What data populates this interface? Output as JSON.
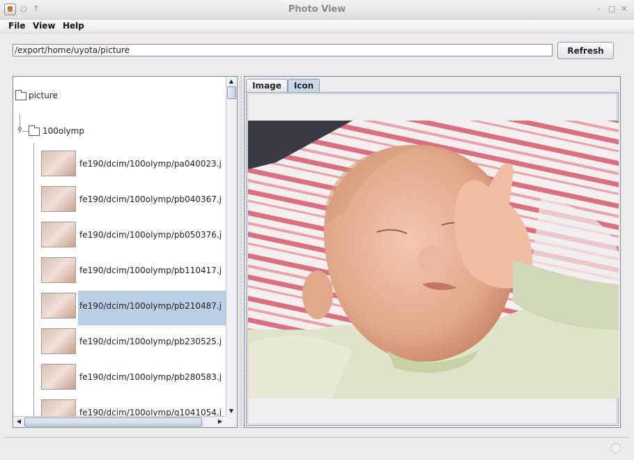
{
  "window": {
    "title": "Photo View",
    "icons": [
      "app-icon",
      "circle-icon",
      "up-arrow-icon",
      "minimize-icon",
      "maximize-icon",
      "close-icon"
    ]
  },
  "menubar": {
    "items": [
      "File",
      "View",
      "Help"
    ]
  },
  "toolbar": {
    "path_value": "/export/home/uyota/picture",
    "refresh_label": "Refresh"
  },
  "tree": {
    "root_label": "picture",
    "folder_label": "100olymp",
    "items": [
      {
        "label": "fe190/dcim/100olymp/pa040023.j"
      },
      {
        "label": "fe190/dcim/100olymp/pb040367.j"
      },
      {
        "label": "fe190/dcim/100olymp/pb050376.j"
      },
      {
        "label": "fe190/dcim/100olymp/pb110417.j"
      },
      {
        "label": "fe190/dcim/100olymp/pb210487.j"
      },
      {
        "label": "fe190/dcim/100olymp/pb230525.j"
      },
      {
        "label": "fe190/dcim/100olymp/pb280583.j"
      },
      {
        "label": "fe190/dcim/100olymp/q1041054.j"
      }
    ],
    "selected_index": 4
  },
  "tabs": [
    {
      "label": "Image",
      "active": false
    },
    {
      "label": "Icon",
      "active": true
    }
  ],
  "colors": {
    "selection": "#b8cfe5",
    "active_tab": "#c9d8e8",
    "border": "#7a8a99"
  }
}
